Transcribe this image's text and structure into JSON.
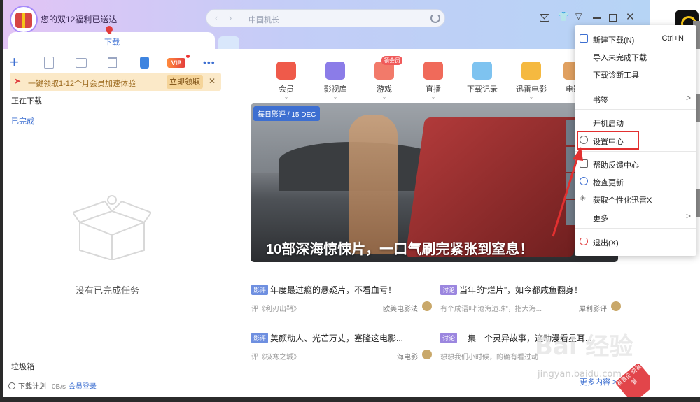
{
  "window": {
    "promo_title": "您的双12福利已送达",
    "download_tab": "下载",
    "address": "中国机长"
  },
  "toolbar": {
    "vip_label": "VIP",
    "more_label": "•••"
  },
  "banner": {
    "text": "一键领取1-12个月会员加速体验",
    "claim": "立即领取",
    "close": "✕"
  },
  "left": {
    "downloading": "正在下载",
    "completed": "已完成",
    "empty_text": "没有已完成任务",
    "trash": "垃圾箱"
  },
  "statusbar": {
    "plan": "下载计划",
    "speed": "0B/s",
    "login": "会员登录"
  },
  "categories": [
    {
      "label": "会员",
      "color": "#ef5a4a"
    },
    {
      "label": "影视库",
      "color": "#8b7ce8"
    },
    {
      "label": "游戏",
      "color": "#f27a6a",
      "badge": "领会员"
    },
    {
      "label": "直播",
      "color": "#f06a5a"
    },
    {
      "label": "下载记录",
      "color": "#7ec3f0"
    },
    {
      "label": "迅雷电影",
      "color": "#f5b940"
    },
    {
      "label": "电影",
      "color": "#e0a060"
    }
  ],
  "hero": {
    "tag": "每日影评 / 15 DEC",
    "title": "10部深海惊悚片，一口气刷完紧张到窒息！"
  },
  "news": [
    {
      "tag": "影评",
      "headline": "年度最过瘾的悬疑片，不看血亏！",
      "sub": "评《利刃出鞘》",
      "source": "欧美电影法"
    },
    {
      "tag": "讨论",
      "headline": "当年的“烂片”，如今都咸鱼翻身！",
      "sub": "有个成语叫“沧海遗珠”，指大海...",
      "source": "犀利影评"
    },
    {
      "tag": "影评",
      "headline": "美颜动人、光芒万丈，塞隆这电影...",
      "sub": "评《极寒之城》",
      "source": "海电影"
    },
    {
      "tag": "讨论",
      "headline": "一集一个灵异故事，这动漫看星耳...",
      "sub": "想想我们小时候，的确有看过动",
      "source": ""
    }
  ],
  "more_content": "更多内容 >",
  "corner_badge": "有意见 说说看",
  "menu": {
    "items": [
      {
        "label": "新建下载(N)",
        "shortcut": "Ctrl+N"
      },
      {
        "label": "导入未完成下载"
      },
      {
        "label": "下载诊断工具"
      },
      {
        "label": "书签",
        "arrow": ">"
      },
      {
        "label": "开机启动"
      },
      {
        "label": "设置中心"
      },
      {
        "label": "帮助反馈中心"
      },
      {
        "label": "检查更新"
      },
      {
        "label": "获取个性化迅雷X"
      },
      {
        "label": "更多",
        "arrow": ">"
      },
      {
        "label": "退出(X)"
      }
    ]
  },
  "watermark": {
    "main": "Bai 经验",
    "sub": "jingyan.baidu.com"
  },
  "colors": {
    "accent": "#3d6fd1",
    "highlight": "#e23030"
  }
}
